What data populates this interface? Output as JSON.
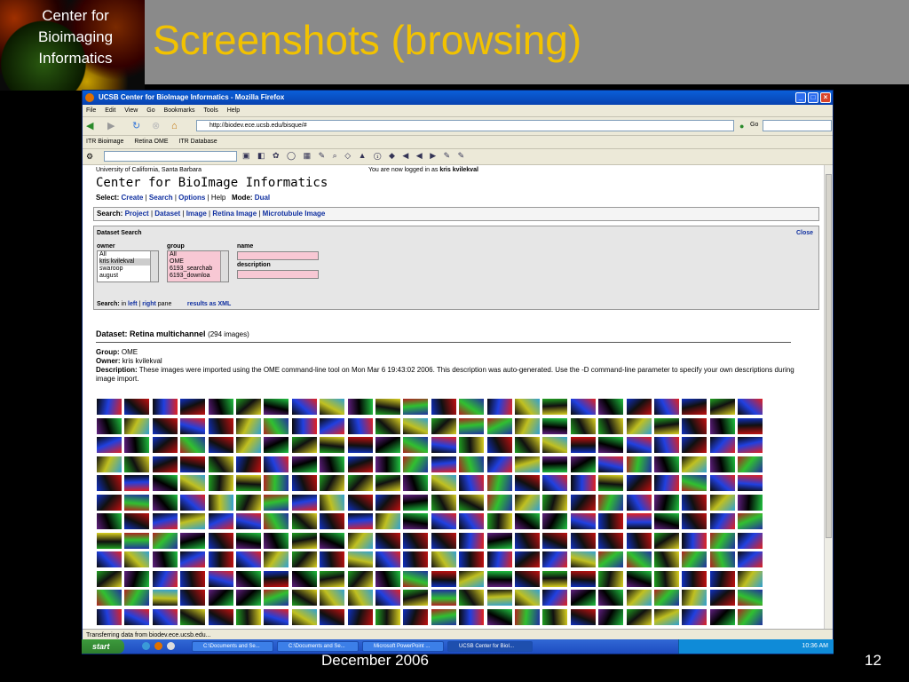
{
  "slide": {
    "logo_text": "Center for\nBioimaging\nInformatics",
    "title": "Screenshots (browsing)",
    "date": "December 2006",
    "number": "12"
  },
  "browser": {
    "window_title": "UCSB Center for BioImage Informatics - Mozilla Firefox",
    "menu": [
      "File",
      "Edit",
      "View",
      "Go",
      "Bookmarks",
      "Tools",
      "Help"
    ],
    "url": "http://biodev.ece.ucsb.edu/bisque/#",
    "go_label": "Go",
    "bookmarks": [
      "ITR Bioimage",
      "Retina OME",
      "ITR Database"
    ],
    "status": "Transferring data from biodev.ece.ucsb.edu..."
  },
  "page": {
    "university": "University of California, Santa Barbara",
    "logged_in_prefix": "You are now logged in as",
    "user": "kris kvilekval",
    "center_title": "Center for BioImage Informatics",
    "select_label": "Select:",
    "select_links": [
      "Create",
      "Search",
      "Options"
    ],
    "help": "Help",
    "mode_label": "Mode:",
    "mode_value": "Dual",
    "search_label": "Search:",
    "search_links": [
      "Project",
      "Dataset",
      "Image",
      "Retina Image",
      "Microtubule Image"
    ],
    "dataset_search": {
      "title": "Dataset Search",
      "close": "Close",
      "owner_label": "owner",
      "owner_options": [
        "All",
        "kris kvilekval",
        "swaroop",
        "august"
      ],
      "group_label": "group",
      "group_options": [
        "All",
        "OME",
        "6193_searchab",
        "6193_downloa"
      ],
      "name_label": "name",
      "description_label": "description",
      "search_in_label": "Search:",
      "search_in_text": "in",
      "left": "left",
      "right": "right",
      "pane": "pane",
      "results_xml": "results as XML"
    },
    "dataset": {
      "label": "Dataset:",
      "name": "Retina multichannel",
      "count": "(294 images)",
      "group_label": "Group:",
      "group": "OME",
      "owner_label": "Owner:",
      "owner": "kris kvilekval",
      "description_label": "Description:",
      "description": "These images were imported using the OME command-line tool on Mon Mar 6 19:43:02 2006. This description was auto-generated. Use the -D command-line parameter to specify your own descriptions during image import."
    }
  },
  "taskbar": {
    "start": "start",
    "items": [
      "C:\\Documents and Se...",
      "C:\\Documents and Se...",
      "Microsoft PowerPoint ...",
      "UCSB Center for BioI..."
    ],
    "clock": "10:36 AM"
  }
}
